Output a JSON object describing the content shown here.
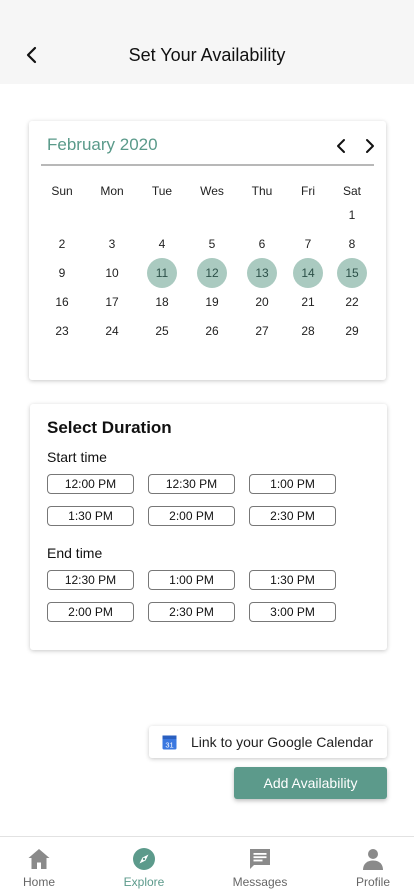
{
  "header": {
    "title": "Set Your Availability",
    "back_icon": "chevron-left-icon"
  },
  "calendar": {
    "month_label": "February 2020",
    "prev_icon": "chevron-left-icon",
    "next_icon": "chevron-right-icon",
    "accent_color": "#5a9a8a",
    "selected_color": "#aacac0",
    "weekdays": [
      "Sun",
      "Mon",
      "Tue",
      "Wes",
      "Thu",
      "Fri",
      "Sat"
    ],
    "weeks": [
      [
        "",
        "",
        "",
        "",
        "",
        "",
        "1"
      ],
      [
        "2",
        "3",
        "4",
        "5",
        "6",
        "7",
        "8"
      ],
      [
        "9",
        "10",
        "11",
        "12",
        "13",
        "14",
        "15"
      ],
      [
        "16",
        "17",
        "18",
        "19",
        "20",
        "21",
        "22"
      ],
      [
        "23",
        "24",
        "25",
        "26",
        "27",
        "28",
        "29"
      ]
    ],
    "selected_days": [
      "11",
      "12",
      "13",
      "14",
      "15"
    ]
  },
  "duration": {
    "title": "Select Duration",
    "start_label": "Start time",
    "start_times": [
      "12:00 PM",
      "12:30 PM",
      "1:00 PM",
      "1:30 PM",
      "2:00 PM",
      "2:30 PM"
    ],
    "end_label": "End time",
    "end_times": [
      "12:30 PM",
      "1:00 PM",
      "1:30 PM",
      "2:00 PM",
      "2:30 PM",
      "3:00 PM"
    ]
  },
  "google_calendar": {
    "label": "Link to your Google Calendar",
    "icon": "google-calendar-icon",
    "icon_text": "31"
  },
  "add_button": {
    "label": "Add Availability",
    "color": "#5c9a8b"
  },
  "bottom_nav": {
    "active": "Explore",
    "items": [
      {
        "label": "Home",
        "icon": "home-icon"
      },
      {
        "label": "Explore",
        "icon": "compass-icon"
      },
      {
        "label": "Messages",
        "icon": "message-icon"
      },
      {
        "label": "Profile",
        "icon": "person-icon"
      }
    ]
  }
}
